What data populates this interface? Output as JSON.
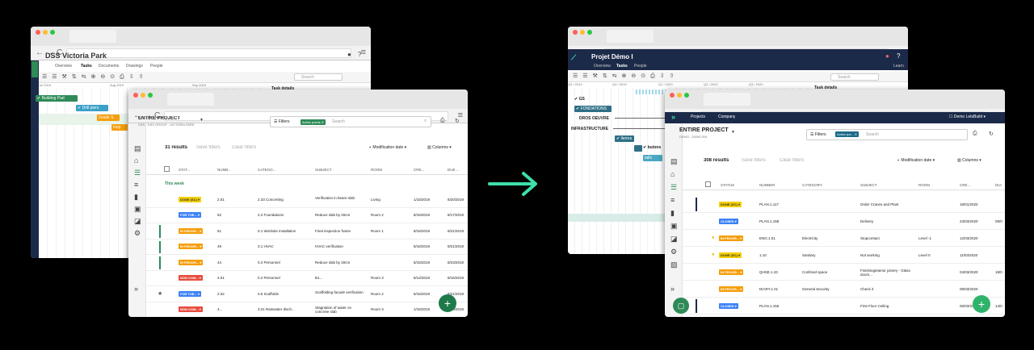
{
  "colors": {
    "accent": "#2e8b57",
    "arrow": "#3de0a8",
    "done": "#f5d000",
    "forthe": "#3b82f6",
    "inprog": "#f59e0b",
    "noncom": "#e74c3c",
    "closed": "#3b82f6",
    "navy": "#1b2a48"
  },
  "left_back": {
    "project": "DSS Victoria Park",
    "tabs": [
      "Overview",
      "Tasks",
      "Documents",
      "Drawings",
      "People"
    ],
    "search_placeholder": "Search",
    "months": [
      "Jul 2019",
      "Aug 2019",
      "Sep 2019"
    ],
    "task_details": "Task details",
    "bars": [
      "Building Pad",
      "Drill piers",
      "Grade S",
      "Insp"
    ]
  },
  "left_front": {
    "project_title": "ENTIRE PROJECT",
    "project_sub": "DSS - DSS GROUP - VICTORIA PARK",
    "filters": "Filters",
    "active_points": "Active points",
    "search_placeholder": "Search",
    "results": "31 results",
    "save_filters": "Save filters",
    "clear_filters": "Clear filters",
    "modification": "Modification date",
    "columns": "Columns",
    "headers": [
      "STAT...",
      "NUMB...",
      "CATEGO...",
      "SUBJECT",
      "ROOM",
      "CRE...",
      "DUE ..."
    ],
    "section": "This week",
    "rows": [
      {
        "status": "DONE (SC)",
        "kind": "done",
        "num": "2.01",
        "cat": "2.33 Concreting",
        "subject": "Verification in beam-slab",
        "room": "Living",
        "cre": "1/15/2019",
        "due": "8/20/2019",
        "mark": ""
      },
      {
        "status": "FOR THE...",
        "kind": "forthe",
        "num": "52",
        "cat": "2.2 Foundations",
        "subject": "Reduce slab by 20cm",
        "room": "Room 2",
        "cre": "8/16/2019",
        "due": "8/17/2019",
        "mark": ""
      },
      {
        "status": "IN PROGR...",
        "kind": "inprog",
        "num": "51",
        "cat": "0.1 Worksite installation",
        "subject": "Final inspection frame",
        "room": "Room 1",
        "cre": "8/16/2019",
        "due": "8/21/2019",
        "mark": "bar"
      },
      {
        "status": "IN PROGR...",
        "kind": "inprog",
        "num": "49",
        "cat": "3.1 HVAC",
        "subject": "HVAC verification",
        "room": "",
        "cre": "8/16/2019",
        "due": "8/21/2019",
        "mark": "bar"
      },
      {
        "status": "IN PROGR...",
        "kind": "inprog",
        "num": "44",
        "cat": "0.2 Personnel",
        "subject": "Reduce slab by 20cm",
        "room": "",
        "cre": "8/15/2019",
        "due": "8/23/2019",
        "mark": "bar"
      },
      {
        "status": "NON COM...",
        "kind": "noncom",
        "num": "4.01",
        "cat": "0.2 Personnel",
        "subject": "B1...",
        "room": "Room 3",
        "cre": "8/14/2019",
        "due": "8/16/2019",
        "mark": ""
      },
      {
        "status": "FOR THE...",
        "kind": "forthe",
        "num": "2.02",
        "cat": "0.5 Scaffolds",
        "subject": "Scaffolding facade verification",
        "room": "Room 2",
        "cre": "8/15/2019",
        "due": "8/21/2019",
        "mark": "star"
      },
      {
        "status": "NON COM...",
        "kind": "noncom",
        "num": "4...",
        "cat": "3.21 Rainwater disch...",
        "subject": "Stagnation of water on concrete slab",
        "room": "Room 3",
        "cre": "1/15/2019",
        "due": "8/16/2019",
        "mark": ""
      }
    ]
  },
  "right_back": {
    "project": "Projet Démo I",
    "tabs": [
      "Overview",
      "Tasks",
      "People"
    ],
    "learn": "Learn",
    "search_placeholder": "Search",
    "quarters": [
      "Q3 / 2019",
      "Q4 / 2019",
      "Q1 / 2020",
      "Q2 / 2020",
      "Q3 / 2020"
    ],
    "task_details": "Task details",
    "labels": [
      "GS",
      "FONDATIONS",
      "DROS OEUVRE",
      "INFRASTRUCTURE",
      "llerres",
      "butons",
      "tallo"
    ]
  },
  "right_front": {
    "nav": [
      "Projects",
      "Company"
    ],
    "user": "Demo LetsBuild",
    "project_title": "ENTIRE PROJECT",
    "project_sub": "DEMO - DEMO EN",
    "filters": "Filters",
    "active_points": "Active poi...",
    "search_placeholder": "Search",
    "results": "308 results",
    "save_filters": "Save filters",
    "clear_filters": "Clear filters",
    "modification": "Modification date",
    "columns": "Columns",
    "headers": [
      "STATUS",
      "NUMBER",
      "CATEGORY",
      "SUBJECT",
      "ROOM",
      "CRE...",
      "DUI"
    ],
    "rows": [
      {
        "status": "DONE (SC)",
        "kind": "done",
        "num": "PLAN.1.117",
        "cat": "",
        "subject": "Order Cranes and Plant",
        "room": "",
        "cre": "18/01/2020",
        "due": "",
        "mark": "navy"
      },
      {
        "status": "CLOSED",
        "kind": "closed",
        "num": "PLAN.1.158",
        "cat": "",
        "subject": "Delivery",
        "room": "",
        "cre": "23/03/2020",
        "due": "09/0",
        "mark": ""
      },
      {
        "status": "IN PROGR...",
        "kind": "inprog",
        "num": "ENG.1.01",
        "cat": "Electricity",
        "subject": "Stopcontact",
        "room": "Level -1",
        "cre": "12/03/2020",
        "due": "",
        "mark": "dot"
      },
      {
        "status": "DONE (SC)",
        "kind": "done",
        "num": "1.10",
        "cat": "Sanitary",
        "subject": "Not working",
        "room": "Level 0",
        "cre": "11/03/2020",
        "due": "",
        "mark": "dot"
      },
      {
        "status": "IN PROGR...",
        "kind": "inprog",
        "num": "QHSE.1.43",
        "cat": "Confined space",
        "subject": "Finishinginterior joinery - Glass doors...",
        "room": "",
        "cre": "04/03/2020",
        "due": "18/0",
        "mark": ""
      },
      {
        "status": "IN PROGR...",
        "kind": "inprog",
        "num": "DIARY.1.01",
        "cat": "General Security",
        "subject": "Check it",
        "room": "",
        "cre": "09/03/2020",
        "due": "",
        "mark": ""
      },
      {
        "status": "CLOSED",
        "kind": "closed",
        "num": "PLAN.1.156",
        "cat": "",
        "subject": "First Floor Ceiling",
        "room": "",
        "cre": "05/03/2020",
        "due": "14/0",
        "mark": "navy"
      }
    ]
  }
}
